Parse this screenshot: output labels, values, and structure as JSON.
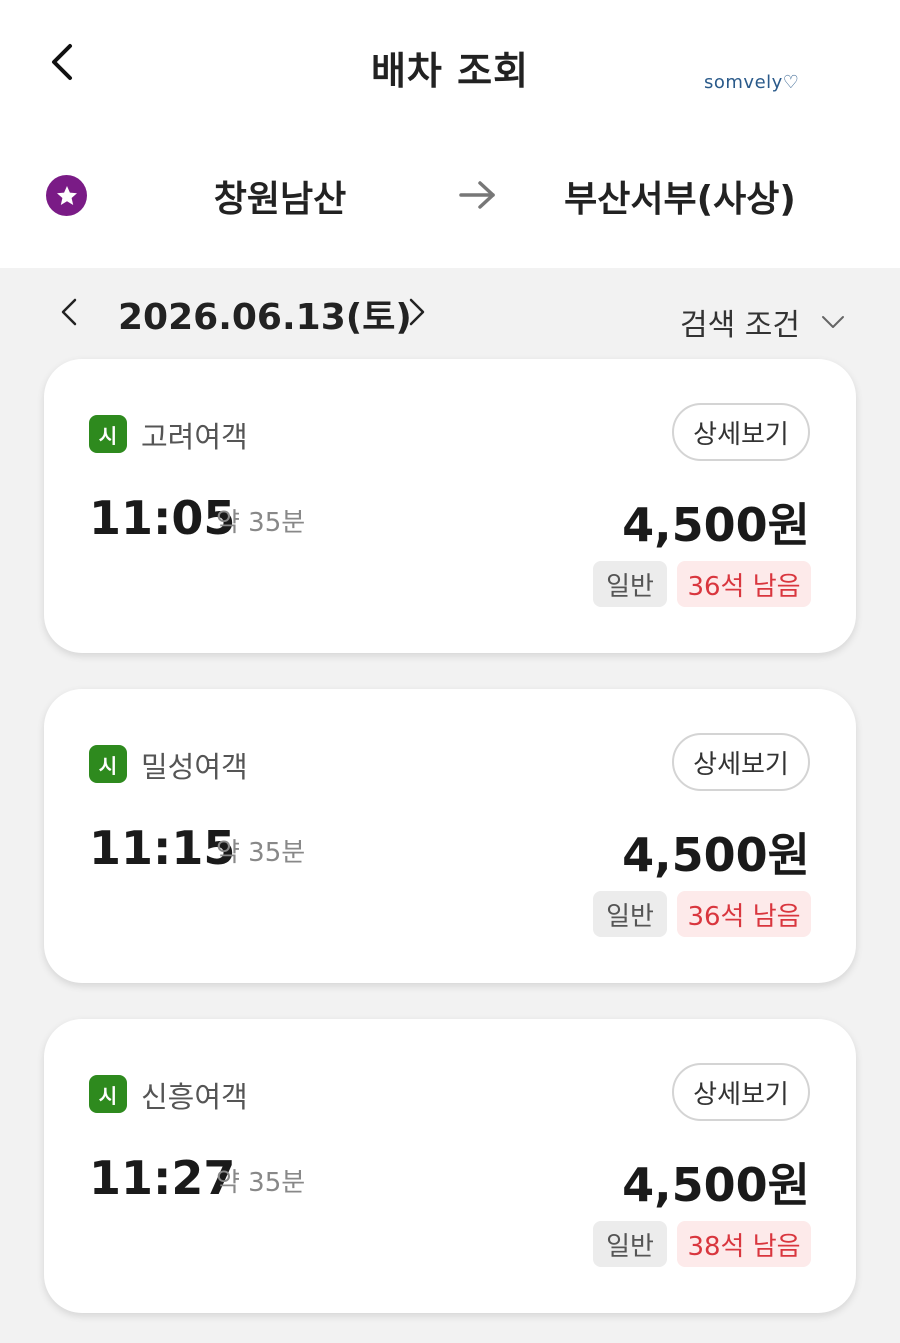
{
  "header": {
    "title": "배차 조회",
    "watermark": "somvely♡"
  },
  "route": {
    "from": "창원남산",
    "to": "부산서부(사상)"
  },
  "date": {
    "label": "2026.06.13(토)",
    "search_condition": "검색 조건"
  },
  "colors": {
    "favorite": "#7a1b86",
    "city_badge": "#2e8a1e",
    "seats_text": "#d9363e"
  },
  "schedules": [
    {
      "badge": "시",
      "company": "고려여객",
      "time": "11:05",
      "duration": "약 35분",
      "price": "4,500원",
      "seat_class": "일반",
      "seats_left": "36석 남음",
      "detail_label": "상세보기"
    },
    {
      "badge": "시",
      "company": "밀성여객",
      "time": "11:15",
      "duration": "약 35분",
      "price": "4,500원",
      "seat_class": "일반",
      "seats_left": "36석 남음",
      "detail_label": "상세보기"
    },
    {
      "badge": "시",
      "company": "신흥여객",
      "time": "11:27",
      "duration": "약 35분",
      "price": "4,500원",
      "seat_class": "일반",
      "seats_left": "38석 남음",
      "detail_label": "상세보기"
    }
  ]
}
